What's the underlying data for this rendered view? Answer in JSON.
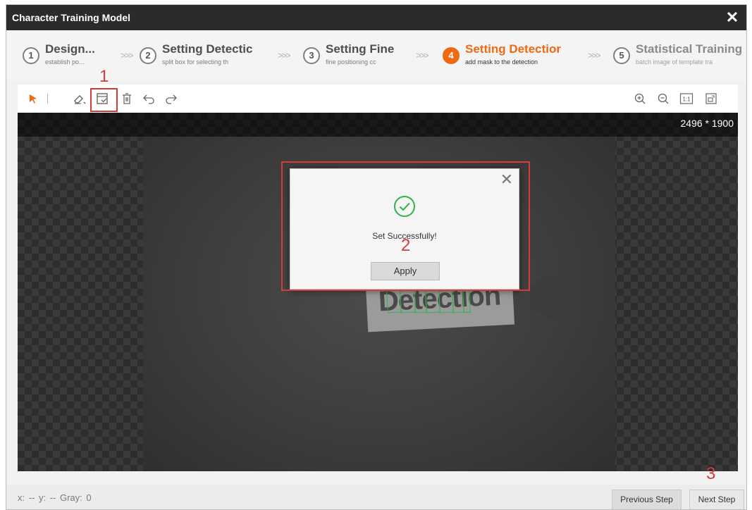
{
  "window": {
    "title": "Character Training Model",
    "close_icon": "close-icon"
  },
  "steps": [
    {
      "num": "1",
      "title": "Design...",
      "sub": "establish po...",
      "state": "done"
    },
    {
      "num": "2",
      "title": "Setting Detectic",
      "sub": "split box for selecting th",
      "state": "done"
    },
    {
      "num": "3",
      "title": "Setting Fine",
      "sub": "fine positioning cc",
      "state": "done"
    },
    {
      "num": "4",
      "title": "Setting Detectior",
      "sub": "add mask to the detection",
      "state": "active"
    },
    {
      "num": "5",
      "title": "Statistical Training",
      "sub": "batch image of template tra",
      "state": "pending"
    }
  ],
  "step_arrow": ">>>",
  "toolbar": {
    "left_tools": [
      "select-arrow-icon",
      "eraser-icon",
      "apply-mask-icon",
      "delete-icon",
      "undo-icon",
      "redo-icon"
    ],
    "right_tools": [
      "zoom-in-icon",
      "zoom-out-icon",
      "actual-size-icon",
      "fit-window-icon"
    ],
    "actual_size_label": "1:1",
    "accent": "#ee6a12"
  },
  "canvas": {
    "image_size": "2496 * 1900",
    "label_text": "Detection"
  },
  "dialog": {
    "message": "Set Successfully!",
    "apply_label": "Apply",
    "success_color": "#2fb24a"
  },
  "annotations": [
    "1",
    "2",
    "3"
  ],
  "annotation_color": "#d63b3b",
  "status": {
    "text": "x: --  y: --    Gray: 0"
  },
  "buttons": {
    "previous": "Previous Step",
    "next": "Next Step"
  }
}
